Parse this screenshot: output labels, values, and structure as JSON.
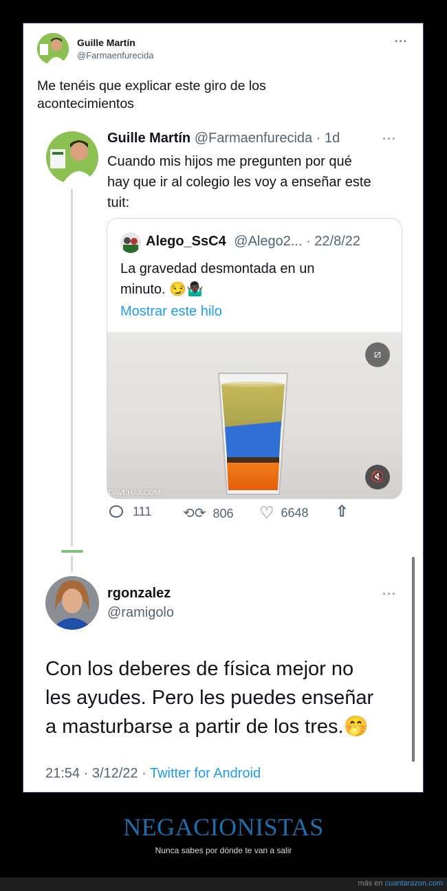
{
  "outer_tweet": {
    "author_name": "Guille Martín",
    "author_handle": "@Farmaenfurecida",
    "text_line1": "Me tenéis que explicar este giro de los",
    "text_line2": "acontecimientos",
    "more_glyph": "···"
  },
  "screenshot_tweet": {
    "author_name": "Guille Martín",
    "meta": "@Farmaenfurecida · 1d",
    "more_glyph": "···",
    "text_line1": "Cuando mis hijos me pregunten por qué",
    "text_line2": "hay que ir al colegio les voy a enseñar este",
    "text_line3": "tuit:",
    "quoted": {
      "author_name": "Alego_SsC4",
      "meta": "@Alego2... · 22/8/22",
      "text_line1": "La gravedad desmontada en un",
      "text_line2": "minuto.",
      "emoji": "😏🤷🏿‍♂️",
      "show_thread": "Mostrar este hilo",
      "video_watermark": "DAVEHAX.COM"
    },
    "actions": {
      "replies": "111",
      "retweets": "806",
      "likes": "6648"
    }
  },
  "reply_tweet": {
    "author_name": "rgonzalez",
    "author_handle": "@ramigolo",
    "more_glyph": "···",
    "text_line1": "Con los deberes de física mejor no",
    "text_line2": "les ayudes. Pero les puedes enseñar",
    "text_line3": "a masturbarse a partir de los tres.",
    "emoji": "🤭",
    "time": "21:54 · 3/12/22 · ",
    "source": "Twitter for Android"
  },
  "caption": {
    "title": "NEGACIONISTAS",
    "subtitle": "Nunca sabes por dónde te van a salir"
  },
  "footer": {
    "prefix": "más en ",
    "site": "cuantarazon.com"
  },
  "colors": {
    "link_blue": "#1d9bf0",
    "caption_blue": "#1e6fae",
    "thread_line": "#cfd9de"
  }
}
